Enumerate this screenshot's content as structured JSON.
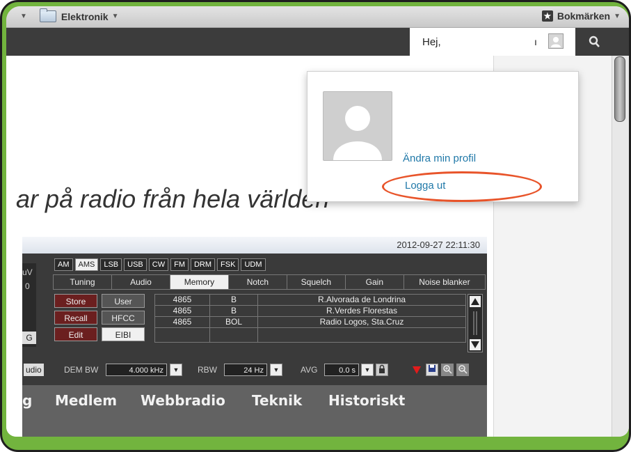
{
  "bookmarks_bar": {
    "folder_label": "Elektronik",
    "bookmarks_label": "Bokmärken"
  },
  "header": {
    "greeting": "Hej,",
    "username_fragment": "ı"
  },
  "user_menu": {
    "edit_profile": "Ändra min profil",
    "logout": "Logga ut"
  },
  "page": {
    "slogan": "ar på radio från hela världen"
  },
  "radio": {
    "datetime": "2012-09-27 22:11:30",
    "modes": [
      "AM",
      "AMS",
      "LSB",
      "USB",
      "CW",
      "FM",
      "DRM",
      "FSK",
      "UDM"
    ],
    "active_mode": "AMS",
    "tabs": [
      "Tuning",
      "Audio",
      "Memory",
      "Notch",
      "Squelch",
      "Gain",
      "Noise blanker"
    ],
    "active_tab": "Memory",
    "buttons": {
      "store": "Store",
      "user": "User",
      "recall": "Recall",
      "hfcc": "HFCC",
      "edit": "Edit",
      "eibi": "EIBI"
    },
    "left_fragments": [
      "uV",
      "0",
      "G"
    ],
    "memory_rows": [
      {
        "freq": "4865",
        "code": "B",
        "name": "R.Alvorada de Londrina"
      },
      {
        "freq": "4865",
        "code": "B",
        "name": "R.Verdes Florestas"
      },
      {
        "freq": "4865",
        "code": "BOL",
        "name": "Radio Logos, Sta.Cruz"
      }
    ],
    "controls": {
      "audio_fragment": "udio",
      "dem_bw_label": "DEM BW",
      "dem_bw_value": "4.000 kHz",
      "rbw_label": "RBW",
      "rbw_value": "24 Hz",
      "avg_label": "AVG",
      "avg_value": "0.0 s"
    }
  },
  "nav": {
    "items": [
      "g",
      "Medlem",
      "Webbradio",
      "Teknik",
      "Historiskt"
    ]
  },
  "colors": {
    "frame_green": "#72b43e",
    "highlight_ellipse": "#e8542a",
    "link_blue": "#1f78a8"
  }
}
